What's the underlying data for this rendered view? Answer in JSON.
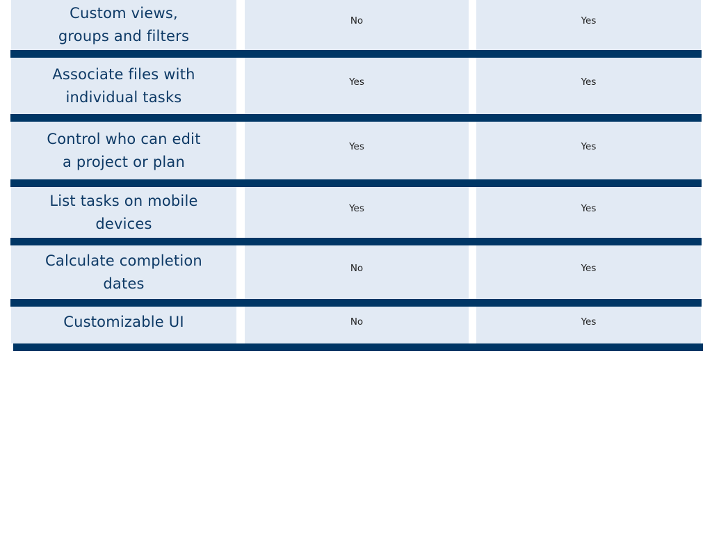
{
  "table": {
    "rows": [
      {
        "feature": "Custom views,\ngroups and filters",
        "feature_lines": [
          "Custom views,",
          "groups and filters"
        ],
        "col2": "No",
        "col3": "Yes"
      },
      {
        "feature": "Associate files with individual tasks",
        "feature_lines": [
          "Associate files with",
          "individual tasks"
        ],
        "col2": "Yes",
        "col3": "Yes"
      },
      {
        "feature": "Control who can edit a project or plan",
        "feature_lines": [
          "Control who can edit",
          "a project or plan"
        ],
        "col2": "Yes",
        "col3": "Yes"
      },
      {
        "feature": "List tasks on mobile devices",
        "feature_lines": [
          "List tasks on mobile",
          "devices"
        ],
        "col2": "Yes",
        "col3": "Yes"
      },
      {
        "feature": "Calculate completion dates",
        "feature_lines": [
          "Calculate completion",
          "dates"
        ],
        "col2": "No",
        "col3": "Yes"
      },
      {
        "feature": "Customizable UI",
        "feature_lines": [
          "Customizable UI"
        ],
        "col2": "No",
        "col3": "Yes"
      }
    ]
  },
  "colors": {
    "cell_bg": "#e2eaf4",
    "divider": "#003665",
    "feature_text": "#0e3a66",
    "value_text": "#222222"
  }
}
